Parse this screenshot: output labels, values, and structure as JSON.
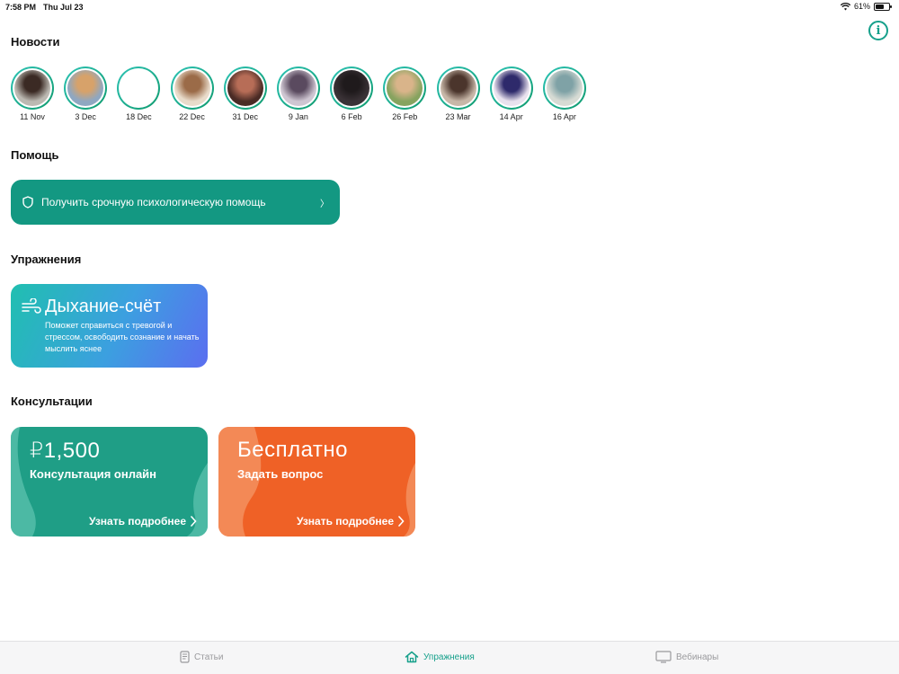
{
  "status_bar": {
    "time": "7:58 PM",
    "date": "Thu Jul 23",
    "battery": "61%",
    "battery_level": 0.61
  },
  "sections": {
    "news": "Новости",
    "help": "Помощь",
    "exercises": "Упражнения",
    "consultations": "Консультации"
  },
  "stories": [
    {
      "date": "11 Nov",
      "colors": [
        "#bcb9b2",
        "#3b2a24"
      ]
    },
    {
      "date": "3 Dec",
      "colors": [
        "#8fa7c1",
        "#d7a26a"
      ]
    },
    {
      "date": "18 Dec",
      "colors": [
        "#ffffff",
        "#ffffff"
      ]
    },
    {
      "date": "22 Dec",
      "colors": [
        "#e9dccb",
        "#9b6b48"
      ]
    },
    {
      "date": "31 Dec",
      "colors": [
        "#4a2b25",
        "#b76d57"
      ]
    },
    {
      "date": "9 Jan",
      "colors": [
        "#cfc6d2",
        "#5a4a5f"
      ]
    },
    {
      "date": "6 Feb",
      "colors": [
        "#3a3236",
        "#1f1a1c"
      ]
    },
    {
      "date": "26 Feb",
      "colors": [
        "#86a35f",
        "#d9b48a"
      ]
    },
    {
      "date": "23 Mar",
      "colors": [
        "#c8b7a8",
        "#4b352c"
      ]
    },
    {
      "date": "14 Apr",
      "colors": [
        "#e9e2ee",
        "#2e2a6b"
      ]
    },
    {
      "date": "16 Apr",
      "colors": [
        "#d7dbd4",
        "#7fa2a6"
      ]
    }
  ],
  "help_card": {
    "label": "Получить срочную психологическую помощь",
    "chevron": "〉"
  },
  "exercise_card": {
    "title": "Дыхание-счёт",
    "description": "Поможет справиться с тревогой и стрессом, освободить сознание и начать мыслить яснее"
  },
  "consultations": [
    {
      "price": "₽1,500",
      "title": "Консультация онлайн",
      "more": "Узнать подробнее"
    },
    {
      "price": "Бесплатно",
      "title": "Задать вопрос",
      "more": "Узнать подробнее"
    }
  ],
  "tabs": [
    {
      "label": "Статьи",
      "icon": "article-icon",
      "active": false
    },
    {
      "label": "Упражнения",
      "icon": "home-icon",
      "active": true
    },
    {
      "label": "Вебинары",
      "icon": "monitor-icon",
      "active": false
    }
  ],
  "colors": {
    "accent": "#16a08b",
    "help_card": "#139882",
    "online_card": "#1f9e86",
    "free_card": "#ef6126"
  }
}
